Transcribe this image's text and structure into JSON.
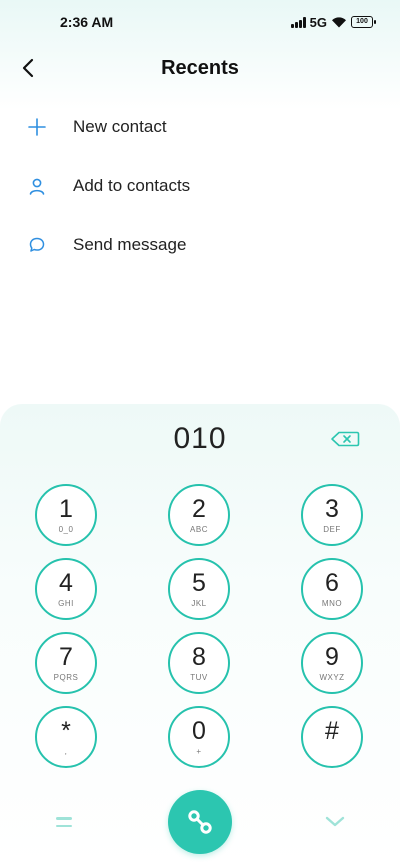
{
  "status_bar": {
    "time": "2:36 AM",
    "network": "5G",
    "battery": "100",
    "icons": [
      "signal-icon",
      "wifi-icon",
      "battery-icon"
    ]
  },
  "header": {
    "title": "Recents",
    "back_icon": "chevron-left-icon"
  },
  "menu": {
    "items": [
      {
        "label": "New contact",
        "icon": "plus-icon"
      },
      {
        "label": "Add to contacts",
        "icon": "person-icon"
      },
      {
        "label": "Send message",
        "icon": "chat-bubble-icon"
      }
    ]
  },
  "dialer": {
    "number": "010",
    "backspace_icon": "backspace-icon",
    "keys": [
      {
        "digit": "1",
        "letters": "0_0"
      },
      {
        "digit": "2",
        "letters": "ABC"
      },
      {
        "digit": "3",
        "letters": "DEF"
      },
      {
        "digit": "4",
        "letters": "GHI"
      },
      {
        "digit": "5",
        "letters": "JKL"
      },
      {
        "digit": "6",
        "letters": "MNO"
      },
      {
        "digit": "7",
        "letters": "PQRS"
      },
      {
        "digit": "8",
        "letters": "TUV"
      },
      {
        "digit": "9",
        "letters": "WXYZ"
      },
      {
        "digit": "*",
        "letters": ","
      },
      {
        "digit": "0",
        "letters": "+"
      },
      {
        "digit": "#",
        "letters": ""
      }
    ]
  },
  "bottom_bar": {
    "menu_icon": "equals-icon",
    "call_icon": "phone-icon",
    "collapse_icon": "chevron-down-icon"
  },
  "colors": {
    "accent": "#2cc6b0",
    "icon_blue": "#2f8fe0"
  }
}
